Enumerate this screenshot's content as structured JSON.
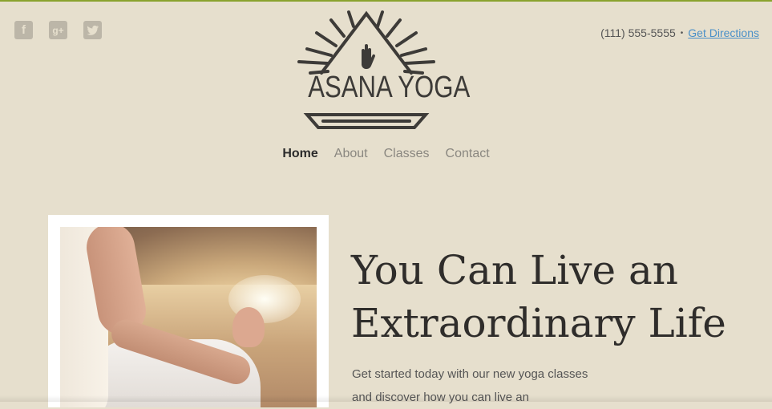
{
  "social": {
    "facebook": {
      "icon": "facebook-icon",
      "glyph": "f"
    },
    "google_plus": {
      "icon": "google-plus-icon",
      "glyph": "g+"
    },
    "twitter": {
      "icon": "twitter-icon"
    }
  },
  "header": {
    "phone": "(111) 555-5555",
    "separator": "•",
    "directions_label": "Get Directions",
    "brand": "ASANA YOGA"
  },
  "nav": {
    "items": [
      {
        "label": "Home",
        "active": true
      },
      {
        "label": "About",
        "active": false
      },
      {
        "label": "Classes",
        "active": false
      },
      {
        "label": "Contact",
        "active": false
      }
    ]
  },
  "hero": {
    "headline": "You Can Live an Extraordinary Life",
    "intro": "Get started today with our new yoga classes and discover how you can live an"
  },
  "colors": {
    "background": "#e6dfcd",
    "top_border": "#8aa22e",
    "link": "#4a90c8",
    "logo": "#3d3b38"
  }
}
